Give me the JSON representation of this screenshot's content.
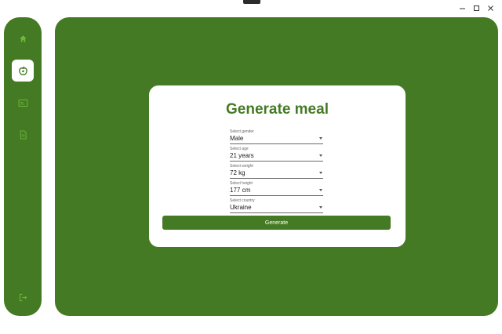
{
  "window": {
    "controls": [
      {
        "name": "minimize",
        "icon": "minimize-icon"
      },
      {
        "name": "maximize",
        "icon": "maximize-icon"
      },
      {
        "name": "close",
        "icon": "close-icon"
      }
    ]
  },
  "colors": {
    "brand": "#447a23",
    "icon_inactive": "#6fb83e",
    "card_bg": "#ffffff"
  },
  "sidebar": {
    "items": [
      {
        "name": "home",
        "icon": "home-icon",
        "active": false
      },
      {
        "name": "meal",
        "icon": "apple-icon",
        "active": true
      },
      {
        "name": "cards",
        "icon": "card-icon",
        "active": false
      },
      {
        "name": "documents",
        "icon": "document-icon",
        "active": false
      }
    ],
    "footer": {
      "name": "logout",
      "icon": "logout-icon"
    }
  },
  "form": {
    "title": "Generate meal",
    "fields": [
      {
        "label": "Select gender",
        "value": "Male"
      },
      {
        "label": "Select age",
        "value": "21 years"
      },
      {
        "label": "Select weight",
        "value": "72 kg"
      },
      {
        "label": "Select height",
        "value": "177 cm"
      },
      {
        "label": "Select country",
        "value": "Ukraine"
      }
    ],
    "submit_label": "Generate"
  }
}
